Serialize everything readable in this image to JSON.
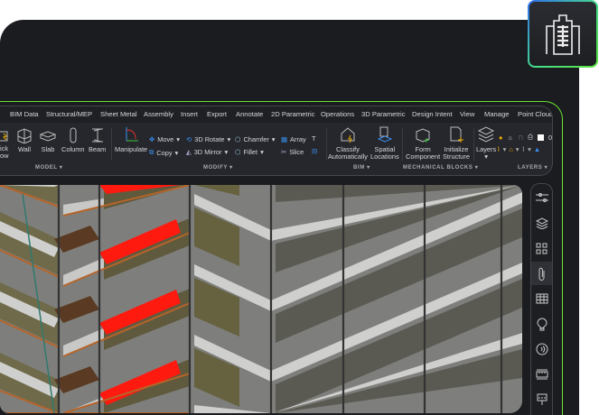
{
  "tabs": [
    "BIM Data",
    "Structural/MEP",
    "Sheet Metal",
    "Assembly",
    "Insert",
    "Export",
    "Annotate",
    "2D Parametric",
    "Operations",
    "3D Parametric",
    "Design Intent",
    "View",
    "Manage",
    "Point Cloud"
  ],
  "tools": {
    "quick_line1": "ick",
    "quick_line2": "ow",
    "wall": "Wall",
    "slab": "Slab",
    "column": "Column",
    "beam": "Beam",
    "manipulate": "Manipulate",
    "move": "Move",
    "copy": "Copy",
    "rotate3d": "3D Rotate",
    "mirror3d": "3D Mirror",
    "chamfer": "Chamfer",
    "fillet": "Fillet",
    "array": "Array",
    "slice": "Slice",
    "classify_l1": "Classify",
    "classify_l2": "Automatically",
    "spatial_l1": "Spatial",
    "spatial_l2": "Locations",
    "form_l1": "Form",
    "form_l2": "Component",
    "init_l1": "Initialize",
    "init_l2": "Structure",
    "layers": "Layers",
    "layer_value": "0"
  },
  "groups": {
    "model": "MODEL",
    "modify": "MODIFY",
    "bim": "BIM",
    "mech": "MECHANICAL BLOCKS",
    "layers": "LAYERS"
  },
  "right_toolbar": [
    "sliders-icon",
    "layers-icon",
    "grid-icon",
    "paperclip-icon",
    "table-icon",
    "balloon-icon",
    "signal-icon",
    "ruler-icon",
    "paint-icon"
  ],
  "colors": {
    "accent": "#6be033",
    "highlight": "#ff1a10"
  }
}
